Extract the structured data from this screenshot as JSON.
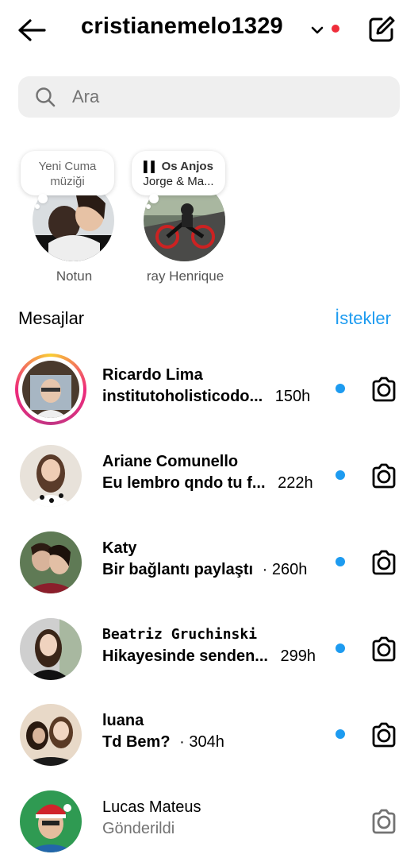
{
  "header": {
    "username": "cristianemelo1329",
    "notification_color": "#ef2d3a"
  },
  "search": {
    "placeholder": "Ara"
  },
  "notes": [
    {
      "bubble_line1": "Yeni Cuma",
      "bubble_line2": "müziği",
      "name": "Notun"
    },
    {
      "bubble_line1": "Os Anjos",
      "bubble_line2": "Jorge & Ma...",
      "name": "ray Henrique"
    }
  ],
  "messages_header": {
    "title": "Mesajlar",
    "requests": "İstekler"
  },
  "conversations": [
    {
      "name": "Ricardo Lima",
      "preview": "institutoholisticodo...",
      "time": "150h",
      "unread": true
    },
    {
      "name": "Ariane Comunello",
      "preview": "Eu lembro qndo tu f...",
      "time": "222h",
      "unread": true
    },
    {
      "name": "Katy",
      "preview": "Bir bağlantı paylaştı",
      "time": "· 260h",
      "unread": true
    },
    {
      "name": "Beatriz Gruchinski",
      "preview": "Hikayesinde senden...",
      "time": "299h",
      "unread": true
    },
    {
      "name": "luana",
      "preview": "Td Bem?",
      "time": "· 304h",
      "unread": true
    },
    {
      "name": "Lucas Mateus",
      "preview": "Gönderildi",
      "time": "",
      "unread": false
    }
  ],
  "colors": {
    "accent": "#1d9bf0",
    "unread_dot": "#1d9bf0"
  }
}
